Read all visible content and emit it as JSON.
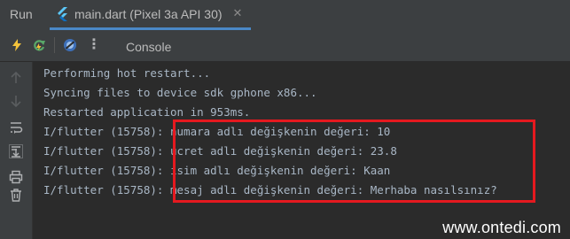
{
  "run_panel": {
    "title": "Run",
    "tab": {
      "label": "main.dart (Pixel 3a API 30)",
      "icon": "flutter-icon",
      "close_glyph": "✕"
    }
  },
  "toolbar": {
    "icons": [
      "hot-reload-icon",
      "hot-restart-icon",
      "dart-devtools-icon",
      "more-options-icon"
    ],
    "more_glyph": "⋮",
    "console_tab_label": "Console"
  },
  "gutter": {
    "icons": [
      "arrow-up-icon",
      "arrow-down-icon",
      "soft-wrap-icon",
      "scroll-to-end-icon",
      "print-icon",
      "trash-icon"
    ]
  },
  "console": {
    "lines": [
      "Performing hot restart...",
      "Syncing files to device sdk gphone x86...",
      "Restarted application in 953ms.",
      "I/flutter (15758): numara adlı değişkenin değeri: 10",
      "I/flutter (15758): ucret adlı değişkenin değeri: 23.8",
      "I/flutter (15758): isim adlı değişkenin değeri: Kaan",
      "I/flutter (15758): mesaj adlı değişkenin değeri: Merhaba nasılsınız?"
    ]
  },
  "watermark": "www.ontedi.com",
  "colors": {
    "panel_bg": "#3c3f41",
    "console_bg": "#2b2b2b",
    "console_text": "#a9b7c6",
    "highlight_border": "#e5191f",
    "tab_underline": "#4a88c7"
  }
}
